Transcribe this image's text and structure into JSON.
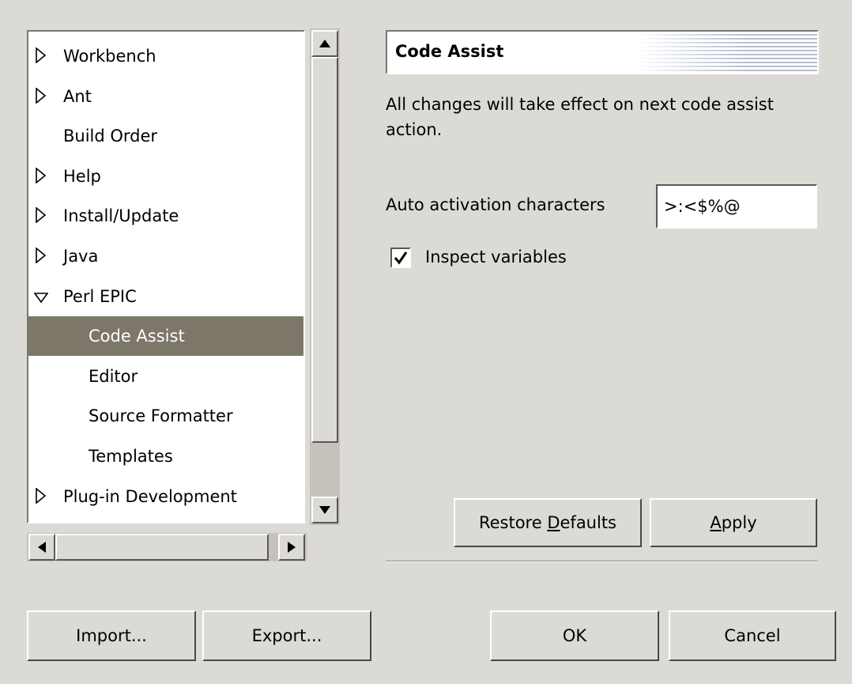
{
  "tree": {
    "items": [
      {
        "label": "Workbench",
        "expander": "collapsed",
        "indent": 0,
        "selected": false
      },
      {
        "label": "Ant",
        "expander": "collapsed",
        "indent": 0,
        "selected": false
      },
      {
        "label": "Build Order",
        "expander": "none",
        "indent": 0,
        "selected": false
      },
      {
        "label": "Help",
        "expander": "collapsed",
        "indent": 0,
        "selected": false
      },
      {
        "label": "Install/Update",
        "expander": "collapsed",
        "indent": 0,
        "selected": false
      },
      {
        "label": "Java",
        "expander": "collapsed",
        "indent": 0,
        "selected": false
      },
      {
        "label": "Perl EPIC",
        "expander": "expanded",
        "indent": 0,
        "selected": false
      },
      {
        "label": "Code Assist",
        "expander": "none",
        "indent": 1,
        "selected": true
      },
      {
        "label": "Editor",
        "expander": "none",
        "indent": 1,
        "selected": false
      },
      {
        "label": "Source Formatter",
        "expander": "none",
        "indent": 1,
        "selected": false
      },
      {
        "label": "Templates",
        "expander": "none",
        "indent": 1,
        "selected": false
      },
      {
        "label": "Plug-in Development",
        "expander": "collapsed",
        "indent": 0,
        "selected": false
      }
    ]
  },
  "page": {
    "title": "Code Assist",
    "description": "All changes will take effect on next code assist action.",
    "auto_activation_label": "Auto activation characters",
    "auto_activation_value": ">:<$%@",
    "inspect_variables_label": "Inspect variables",
    "inspect_variables_checked": true,
    "restore_defaults_pre": "Restore ",
    "restore_defaults_mnemonic": "D",
    "restore_defaults_post": "efaults",
    "apply_mnemonic": "A",
    "apply_post": "pply"
  },
  "footer": {
    "import_label": "Import...",
    "export_label": "Export...",
    "ok_label": "OK",
    "cancel_label": "Cancel"
  },
  "colors": {
    "background": "#dcdad5",
    "selection": "#7c7769",
    "title_stripes": "#b4bfd3"
  },
  "icons": [
    "triangle-right-icon",
    "triangle-down-icon",
    "arrow-up-icon",
    "arrow-down-icon",
    "arrow-left-icon",
    "arrow-right-icon",
    "checkmark-icon"
  ]
}
